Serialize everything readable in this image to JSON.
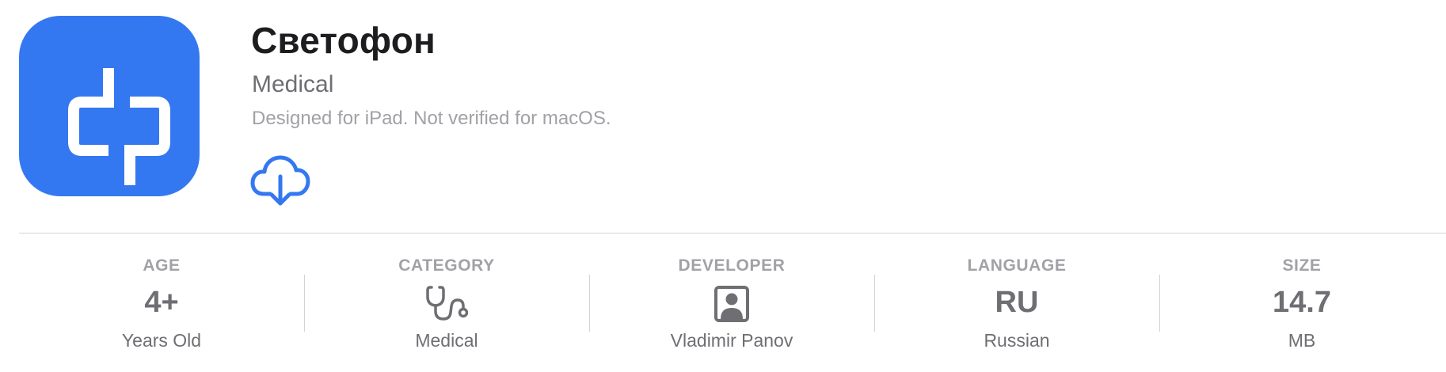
{
  "app": {
    "title": "Светофон",
    "category": "Medical",
    "compatibility_note": "Designed for iPad. Not verified for macOS.",
    "icon": "svetofon-app-icon",
    "icon_color": "#3478f1",
    "download_icon": "cloud-download-icon"
  },
  "info": {
    "age": {
      "label": "AGE",
      "value": "4+",
      "sub": "Years Old"
    },
    "category": {
      "label": "CATEGORY",
      "icon": "stethoscope-icon",
      "sub": "Medical"
    },
    "developer": {
      "label": "DEVELOPER",
      "icon": "person-portrait-icon",
      "sub": "Vladimir Panov"
    },
    "language": {
      "label": "LANGUAGE",
      "value": "RU",
      "sub": "Russian"
    },
    "size": {
      "label": "SIZE",
      "value": "14.7",
      "sub": "MB"
    }
  }
}
